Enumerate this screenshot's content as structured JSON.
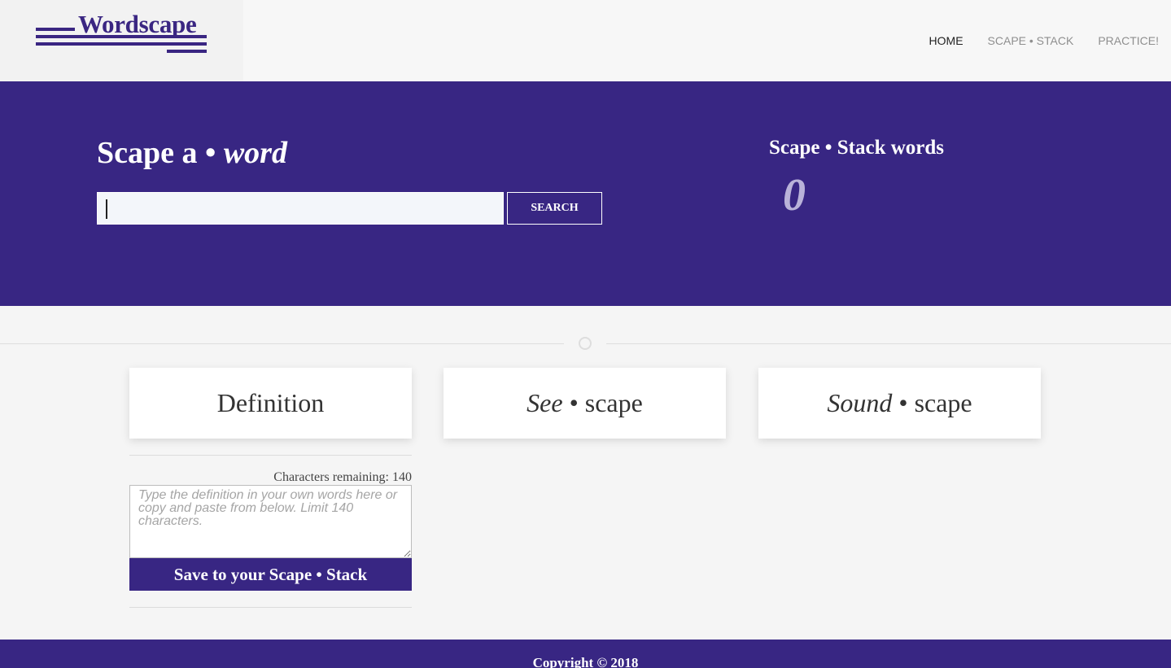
{
  "brand": {
    "name": "Wordscape"
  },
  "nav": {
    "items": [
      {
        "label": "HOME",
        "active": true
      },
      {
        "label": "SCAPE • STACK",
        "active": false
      },
      {
        "label": "PRACTICE!",
        "active": false
      }
    ]
  },
  "hero": {
    "title_prefix": "Scape a • ",
    "title_em": "word",
    "search": {
      "value": "",
      "placeholder": ""
    },
    "search_button": "SEARCH",
    "stack_title": "Scape • Stack words",
    "stack_count": "0"
  },
  "cards": [
    {
      "em": "",
      "rest": "Definition"
    },
    {
      "em": "See",
      "rest": " • scape"
    },
    {
      "em": "Sound",
      "rest": " • scape"
    }
  ],
  "definition": {
    "chars_remaining": "Characters remaining: 140",
    "placeholder": "Type the definition in your own words here or copy and paste from below. Limit 140 characters.",
    "save_button": "Save to your Scape • Stack"
  },
  "footer": {
    "text": "Copyright © 2018"
  },
  "colors": {
    "brand": "#382683",
    "page_bg": "#f5f5f5"
  }
}
